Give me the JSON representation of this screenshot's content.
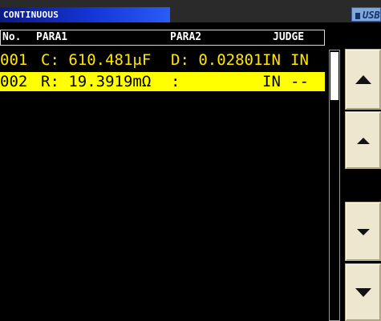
{
  "status_bar": {
    "mode": "CONTINUOUS",
    "usb_label": "USB"
  },
  "table": {
    "columns": [
      "No.",
      "PARA1",
      "PARA2",
      "JUDGE"
    ],
    "rows": [
      {
        "no": "001",
        "para1": "C: 610.481μF",
        "para2": "D: 0.02801",
        "judge1": "IN",
        "judge2": "IN",
        "selected": false
      },
      {
        "no": "002",
        "para1": "R: 19.3919mΩ",
        "para2": ":",
        "judge1": "IN",
        "judge2": "--",
        "selected": true
      }
    ]
  },
  "colors": {
    "text": "#ffe600",
    "selected_background": "#ffff00",
    "button_face": "#ede7d0",
    "mode_bar": "#1436d8"
  },
  "scroll_buttons": [
    {
      "name": "page-up",
      "icon": "triangle-up-large"
    },
    {
      "name": "line-up",
      "icon": "triangle-up-small"
    },
    {
      "name": "line-down",
      "icon": "triangle-down-small"
    },
    {
      "name": "page-down",
      "icon": "triangle-down-large"
    }
  ]
}
